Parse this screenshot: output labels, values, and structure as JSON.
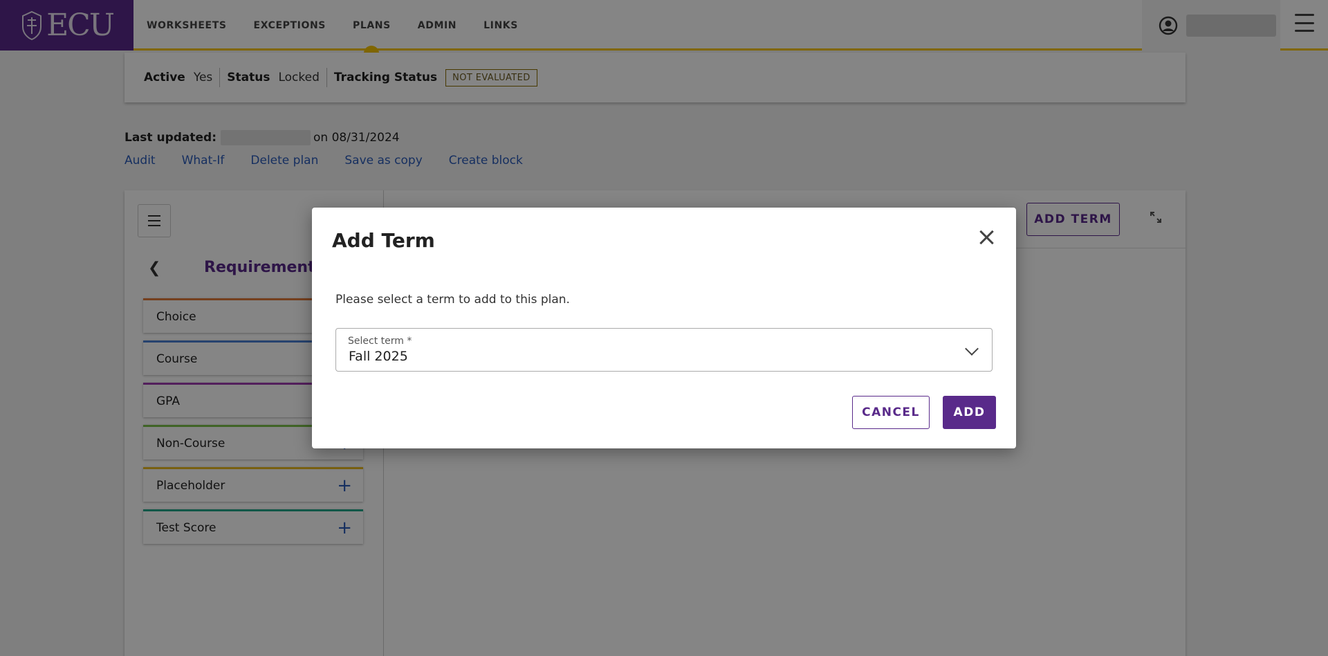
{
  "header": {
    "logo_text": "ECU",
    "nav": [
      "WORKSHEETS",
      "EXCEPTIONS",
      "PLANS",
      "ADMIN",
      "LINKS"
    ],
    "active_nav": "PLANS",
    "icons": [
      "user-circle-icon",
      "hamburger-menu-icon"
    ]
  },
  "status": {
    "active_label": "Active",
    "active_value": "Yes",
    "status_label": "Status",
    "status_value": "Locked",
    "tracking_label": "Tracking Status",
    "tracking_value": "NOT EVALUATED"
  },
  "last_updated": {
    "label": "Last updated:",
    "on_text": "on 08/31/2024"
  },
  "actions": [
    "Audit",
    "What-If",
    "Delete plan",
    "Save as copy",
    "Create block"
  ],
  "requirements": {
    "title": "Requirements",
    "items": [
      {
        "label": "Choice",
        "color": "#e07a3a"
      },
      {
        "label": "Course",
        "color": "#4a7fd4"
      },
      {
        "label": "GPA",
        "color": "#a03cb0"
      },
      {
        "label": "Non-Course",
        "color": "#7cc04a"
      },
      {
        "label": "Placeholder",
        "color": "#e8b820"
      },
      {
        "label": "Test Score",
        "color": "#22a88a"
      }
    ]
  },
  "toolbar": {
    "add_term_label": "ADD TERM"
  },
  "modal": {
    "title": "Add Term",
    "message": "Please select a term to add to this plan.",
    "select_label": "Select term *",
    "select_value": "Fall 2025",
    "cancel_label": "CANCEL",
    "add_label": "ADD"
  },
  "colors": {
    "brand_purple": "#592a8a",
    "accent_gold": "#f5c400",
    "link_blue": "#2b5bb8"
  }
}
